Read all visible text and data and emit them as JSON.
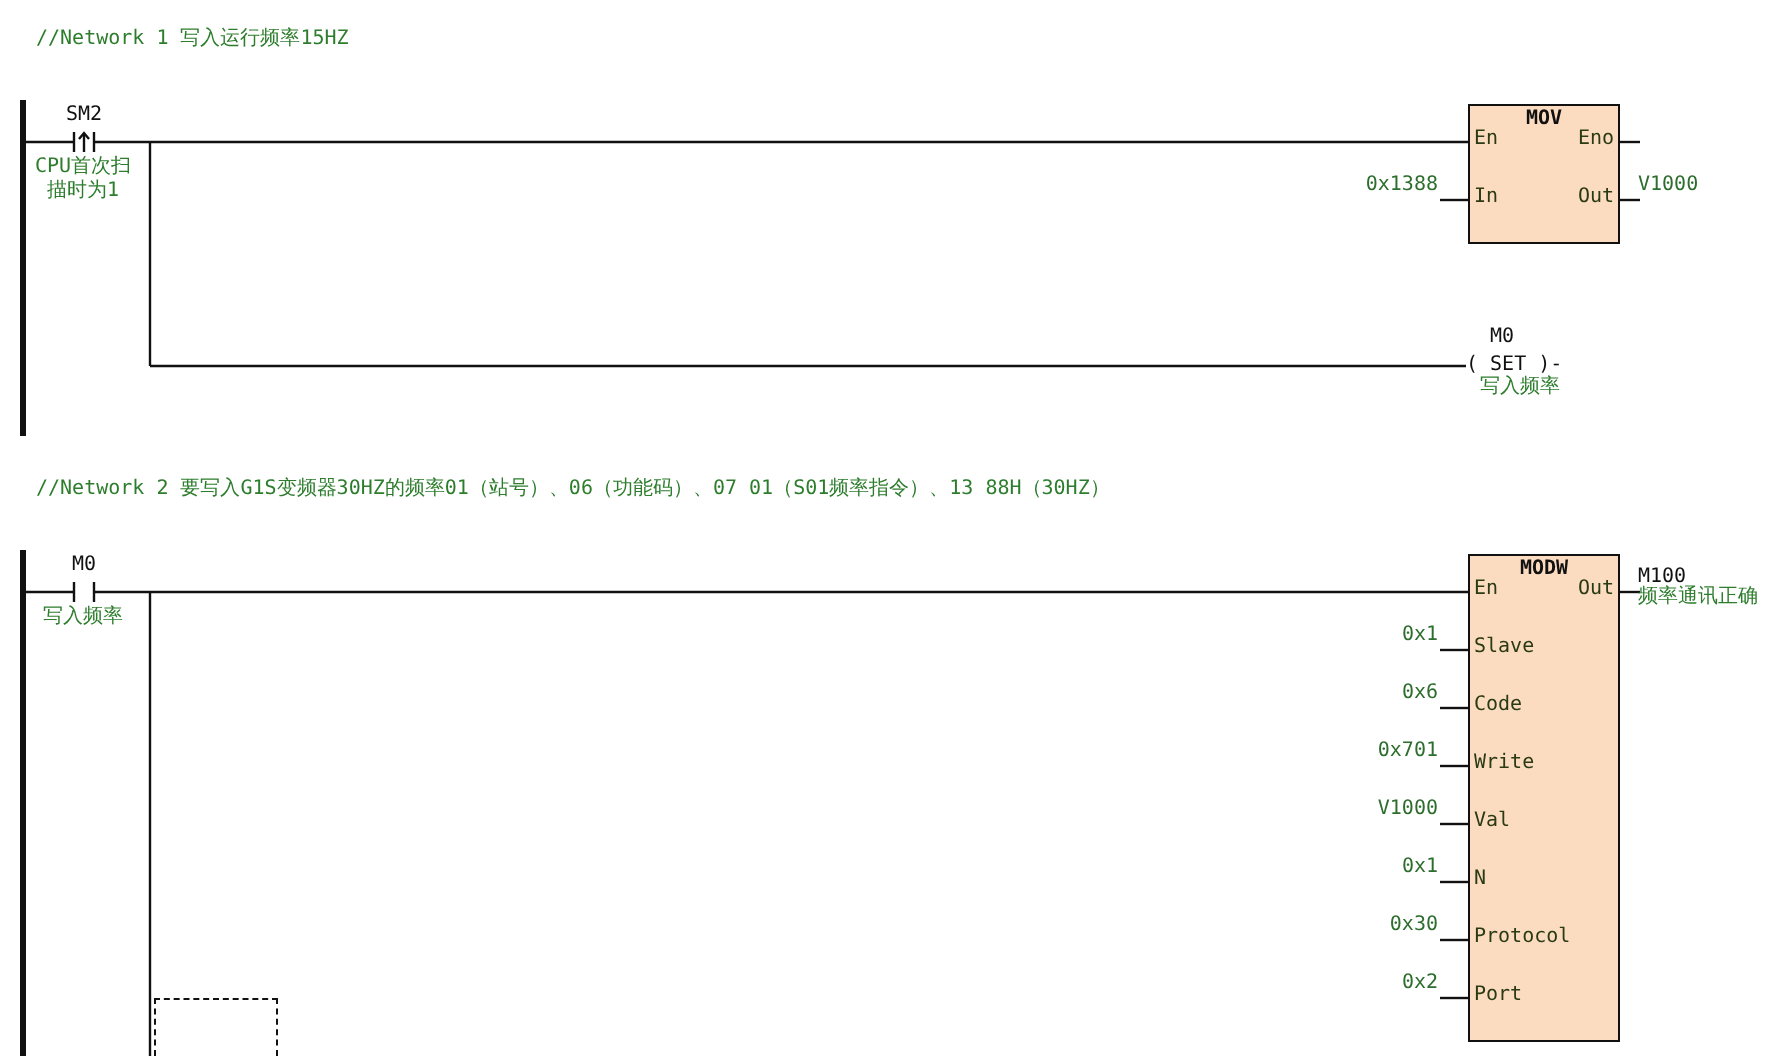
{
  "networks": [
    {
      "comment": "//Network 1  写入运行频率15HZ",
      "contact": {
        "kind": "rising_edge",
        "address": "SM2",
        "note": "CPU首次扫描时为1"
      },
      "block": {
        "name": "MOV",
        "inputs": [
          {
            "label": "En"
          },
          {
            "label": "In",
            "value": "0x1388"
          }
        ],
        "outputs": [
          {
            "label": "Eno"
          },
          {
            "label": "Out",
            "value": "V1000"
          }
        ]
      },
      "coil": {
        "kind": "set_coil",
        "address": "M0",
        "symbol": "( SET )-",
        "note": "写入频率"
      },
      "empty_branch": false
    },
    {
      "comment": "//Network 2  要写入G1S变频器30HZ的频率01（站号）、06（功能码）、07 01（S01频率指令）、13 88H（30HZ）",
      "contact": {
        "kind": "normally_open",
        "address": "M0",
        "note": "写入频率"
      },
      "block": {
        "name": "MODW",
        "inputs": [
          {
            "label": "En"
          },
          {
            "label": "Slave",
            "value": "0x1"
          },
          {
            "label": "Code",
            "value": "0x6"
          },
          {
            "label": "Write",
            "value": "0x701"
          },
          {
            "label": "Val",
            "value": "V1000"
          },
          {
            "label": "N",
            "value": "0x1"
          },
          {
            "label": "Protocol",
            "value": "0x30"
          },
          {
            "label": "Port",
            "value": "0x2"
          }
        ],
        "outputs": [
          {
            "label": "Out",
            "value": "M100",
            "note": "频率通讯正确"
          }
        ]
      },
      "empty_branch": true
    }
  ]
}
